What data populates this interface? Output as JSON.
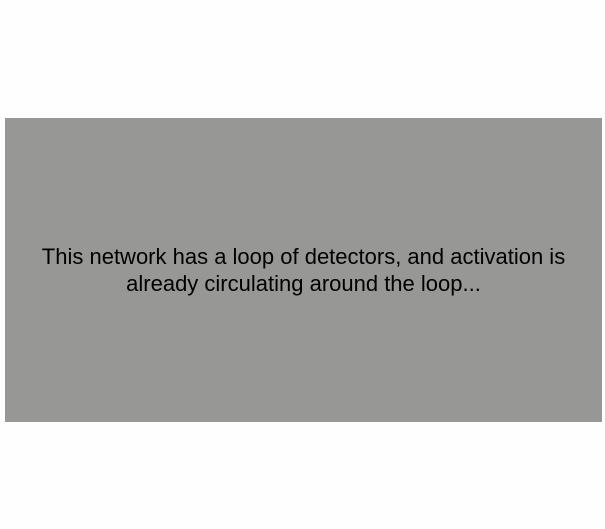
{
  "panel": {
    "message": "This network has a loop of detectors, and activation is already circulating around the loop...",
    "background_color": "#979896",
    "text_color": "#000000"
  },
  "page": {
    "background_color": "#fefefe"
  }
}
